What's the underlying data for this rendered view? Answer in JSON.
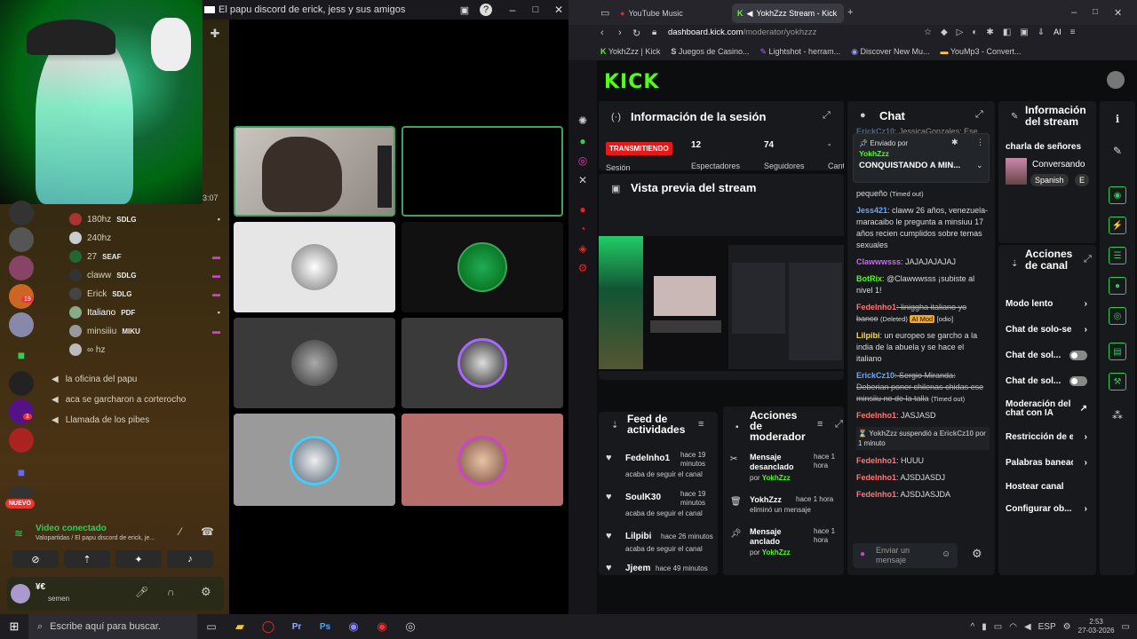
{
  "discord": {
    "window_title": "El papu discord de erick, jess y sus amigos",
    "timer": "3:07",
    "users": [
      {
        "name": "180hz",
        "tag": "SDLG"
      },
      {
        "name": "240hz",
        "tag": ""
      },
      {
        "name": "27",
        "tag": "SEAF"
      },
      {
        "name": "claww",
        "tag": "SDLG"
      },
      {
        "name": "Erick",
        "tag": "SDLG"
      },
      {
        "name": "Italiano",
        "tag": "PDF"
      },
      {
        "name": "minsiiiu",
        "tag": "MIKU"
      },
      {
        "name": "∞ hz",
        "tag": ""
      }
    ],
    "channels": [
      "la oficina del papu",
      "aca se garcharon a corterocho",
      "Llamada de los pibes"
    ],
    "badge_nuevo": "NUEVO",
    "server_badge_1": "19",
    "server_badge_2": "1",
    "voice": {
      "status": "Video conectado",
      "detail": "Valopartidas / El papu discord de erick, je..."
    },
    "user": {
      "name": "semen",
      "tag": "¥€"
    }
  },
  "browser": {
    "tabs": [
      "YouTube Music",
      "YokhZzz Stream - Kick"
    ],
    "url_domain": "dashboard.kick.com",
    "url_path": "/moderator/yokhzzz",
    "bookmarks": [
      "YokhZzz | Kick",
      "Juegos de Casino...",
      "Lightshot - herram...",
      "Discover New Mu...",
      "YouMp3 - Convert..."
    ],
    "ai_label": "AI"
  },
  "kick": {
    "logo": "KICK",
    "session": {
      "title": "Información de la sesión",
      "live": "TRANSMITIENDO",
      "viewers": "12",
      "viewers_label": "Espectadores",
      "followers": "74",
      "followers_label": "Seguidores",
      "dash": "-",
      "partial1": "Sesión",
      "partial2": "Cant"
    },
    "preview_title": "Vista previa del stream",
    "feed": {
      "title": "Feed de actividades",
      "items": [
        {
          "user": "Fedelnho1",
          "time": "hace 19 minutos",
          "action": "acaba de seguir el canal"
        },
        {
          "user": "SoulK30",
          "time": "hace 19 minutos",
          "action": "acaba de seguir el canal"
        },
        {
          "user": "Lilpibi",
          "time": "hace 26 minutos",
          "action": "acaba de seguir el canal"
        },
        {
          "user": "Jjeem",
          "time": "hace 49 minutos",
          "action": ""
        }
      ]
    },
    "modactions": {
      "title": "Acciones de moderador",
      "items": [
        {
          "title": "Mensaje desanclado",
          "by": "por",
          "user": "YokhZzz",
          "time": "hace 1 hora"
        },
        {
          "title": "YokhZzz",
          "sub": "eliminó un mensaje",
          "time": "hace 1 hora"
        },
        {
          "title": "Mensaje anclado",
          "by": "por",
          "user": "YokhZzz",
          "time": "hace 1 hora"
        }
      ]
    },
    "chat": {
      "title": "Chat",
      "pinned_label": "Enviado por",
      "pinned_user": "YokhZzz",
      "pinned_msg": "CONQUISTANDO A MIN...",
      "top_user": "ErickCz10",
      "top_text": ": JessicaGonzales: Ese",
      "partial": "pequeño",
      "partial_tag": "(Timed out)",
      "msgs": [
        {
          "user": "Jess421",
          "text": ": claww 26 años, venezuela-maracaibo le pregunta a minsiuu 17 años recien cumplidos sobre temas sexuales"
        },
        {
          "user": "Clawwwsss",
          "text": ": JAJAJAJAJAJ"
        },
        {
          "user": "BotRix",
          "text": ": @Clawwwsss ¡subiste al nivel 1!"
        },
        {
          "user": "Fedelnho1",
          "text": ": liniggha italiano yo banco",
          "tag": "(Deleted)",
          "mod": "AI Mod",
          "mod2": "[odio]"
        },
        {
          "user": "Lilpibi",
          "text": ": un europeo se garcho a la india de la abuela y se hace el italiano"
        },
        {
          "user": "ErickCz10",
          "text": ": Sergio Miranda: Deberian poner chilenas chidas ese minsiiu no de la talla",
          "tag": "(Timed out)"
        },
        {
          "user": "Fedelnho1",
          "text": ": JASJASD"
        },
        {
          "user": "Fedelnho1",
          "text": ": HUUU"
        },
        {
          "user": "Fedelnho1",
          "text": ": AJSDJASDJ"
        },
        {
          "user": "Fedelnho1",
          "text": ": AJSDJASJDA"
        }
      ],
      "timeout": {
        "user": "YokhZzz",
        "action": "suspendió a",
        "target": "ErickCz10",
        "dur": "por 1 minuto"
      },
      "placeholder": "Enviar un mensaje"
    },
    "streaminfo": {
      "title": "Información del stream",
      "stream_title": "charla de señores",
      "category": "Conversando",
      "lang": "Spanish",
      "lang2": "E"
    },
    "channel": {
      "title": "Acciones de canal",
      "items": [
        {
          "label": "Modo lento",
          "type": "arrow"
        },
        {
          "label": "Chat de solo-se",
          "type": "arrow"
        },
        {
          "label": "Chat de sol...",
          "type": "toggle"
        },
        {
          "label": "Chat de sol...",
          "type": "toggle"
        },
        {
          "label": "Moderación del chat con IA",
          "type": "link"
        },
        {
          "label": "Restricción de e",
          "type": "arrow"
        },
        {
          "label": "Palabras baneac",
          "type": "arrow"
        },
        {
          "label": "Hostear canal",
          "type": "none"
        },
        {
          "label": "Configurar ob...",
          "type": "arrow"
        }
      ]
    }
  },
  "taskbar": {
    "search": "Escribe aquí para buscar.",
    "lang": "ESP",
    "time": "2:53",
    "date": "27-03-2026"
  }
}
